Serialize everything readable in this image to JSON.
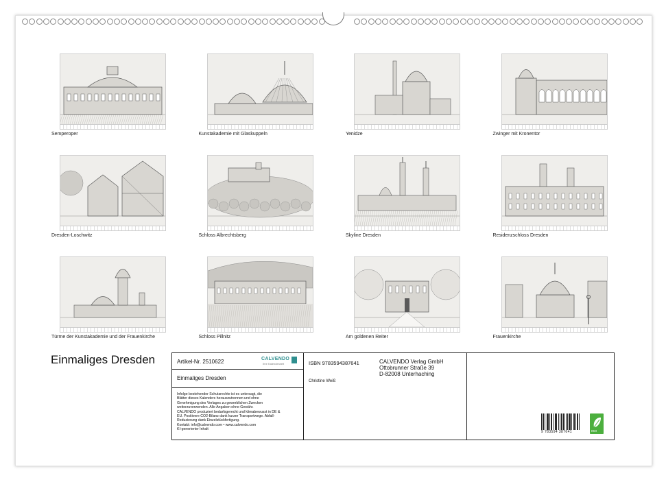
{
  "title": "Einmaliges Dresden",
  "months": [
    {
      "caption": "Semperoper",
      "icon": "opera-house"
    },
    {
      "caption": "Kunstakademie mit Glaskuppeln",
      "icon": "glass-dome"
    },
    {
      "caption": "Yenidze",
      "icon": "mosque-dome"
    },
    {
      "caption": "Zwinger mit Kronentor",
      "icon": "crown-gate"
    },
    {
      "caption": "Dresden-Loschwitz",
      "icon": "half-timbered-houses"
    },
    {
      "caption": "Schloss Albrechtsberg",
      "icon": "castle-hill"
    },
    {
      "caption": "Skyline Dresden",
      "icon": "skyline"
    },
    {
      "caption": "Residenzschloss Dresden",
      "icon": "residence-palace"
    },
    {
      "caption": "Türme der Kunstakademie und der Frauenkirche",
      "icon": "church-towers"
    },
    {
      "caption": "Schloss Pillnitz",
      "icon": "riverside-palace"
    },
    {
      "caption": "Am goldenen Reiter",
      "icon": "winter-square"
    },
    {
      "caption": "Frauenkirche",
      "icon": "frauenkirche"
    }
  ],
  "info": {
    "article": "Artikel-Nr. 2510622",
    "logo": "CALVENDO",
    "logo_sub": "Ihre Kalenderwelt",
    "calendar_title": "Einmaliges Dresden",
    "legal_lines": [
      "Infolge bestehender Schutzrechte ist es untersagt, die",
      "Blätter dieses Kalenders herauszutrennen und ohne",
      "Genehmigung des Verlages zu gewerblichen Zwecken",
      "weiterzuverwenden. Alle Angaben ohne Gewähr.",
      "CALVENDO produziert bedarfsgerecht und klimabewusst in DE &",
      "EU. Positivere CO2-Bilanz dank kurzer Transportwege. Abfall-",
      "Reduzierung dank Einzelstückfertigung.",
      "Kontakt: info@calvendo.com • www.calvendo.com",
      "KI-generierter Inhalt"
    ],
    "isbn": "ISBN 9783594387641",
    "author": "Christine Weiß",
    "publisher_lines": [
      "CALVENDO Verlag GmbH",
      "Ottobrunner Straße 39",
      "D-82008 Unterhaching"
    ],
    "barcode_number": "9 783594 387641",
    "eco_label": "eco"
  }
}
